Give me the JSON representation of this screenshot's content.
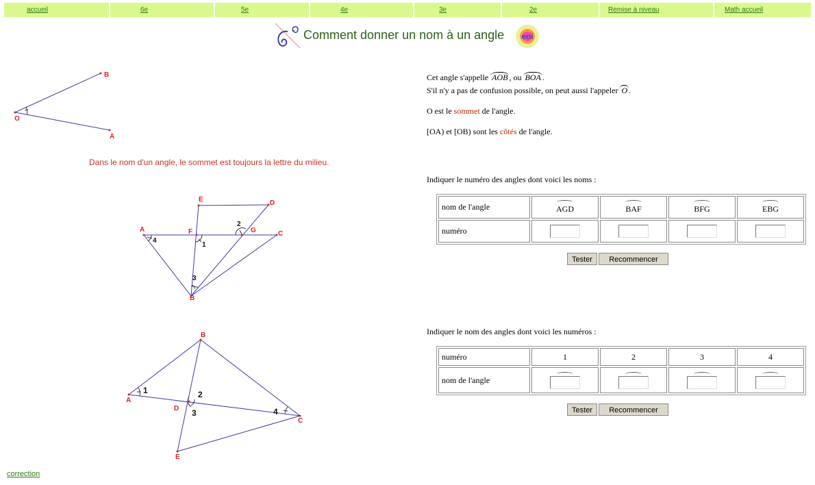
{
  "nav": [
    "accueil",
    "6e",
    "5e",
    "4e",
    "3e",
    "2e",
    "Remise à niveau",
    "Math accueil"
  ],
  "title": "Comment donner un nom à un angle",
  "logo_text": "eoi",
  "explain": {
    "l1a": "Cet angle s'appelle",
    "aob": "AOB",
    "l1b": ", ou",
    "boa": "BOA",
    "l1c": ".",
    "l2a": "S'il n'y a pas de confusion possible, on peut aussi l'appeler",
    "o": "O",
    "l2b": ".",
    "l3a": "O est le",
    "sommet": "sommet",
    "l3b": "de l'angle.",
    "l4a": "[OA) et [OB) sont les",
    "cotes": "côtés",
    "l4b": "de l'angle."
  },
  "rule": "Dans le nom d'un angle, le sommet est toujours la lettre du milieu.",
  "ex1": {
    "instruction": "Indiquer le numéro des angles dont voici les noms :",
    "row1_label": "nom de l'angle",
    "names": [
      "AGD",
      "BAF",
      "BFG",
      "EBG"
    ],
    "row2_label": "numéro"
  },
  "ex2": {
    "instruction": "Indiquer le nom des angles dont voici les numéros :",
    "row1_label": "numéro",
    "numbers": [
      "1",
      "2",
      "3",
      "4"
    ],
    "row2_label": "nom de l'angle"
  },
  "buttons": {
    "test": "Tester",
    "restart": "Recommencer"
  },
  "fig1": {
    "points": [
      "B",
      "O",
      "A"
    ]
  },
  "fig2": {
    "points": [
      "E",
      "D",
      "A",
      "F",
      "G",
      "C",
      "B"
    ],
    "angles": [
      "4",
      "1",
      "2",
      "3"
    ]
  },
  "fig3": {
    "points": [
      "B",
      "A",
      "D",
      "C",
      "E"
    ],
    "angles": [
      "1",
      "2",
      "3",
      "4"
    ]
  },
  "correction": "correction",
  "colors": {
    "nav_bg": "#d9f98f",
    "link": "#2e7a10",
    "line": "#3a3ab0",
    "label": "#e02020"
  }
}
